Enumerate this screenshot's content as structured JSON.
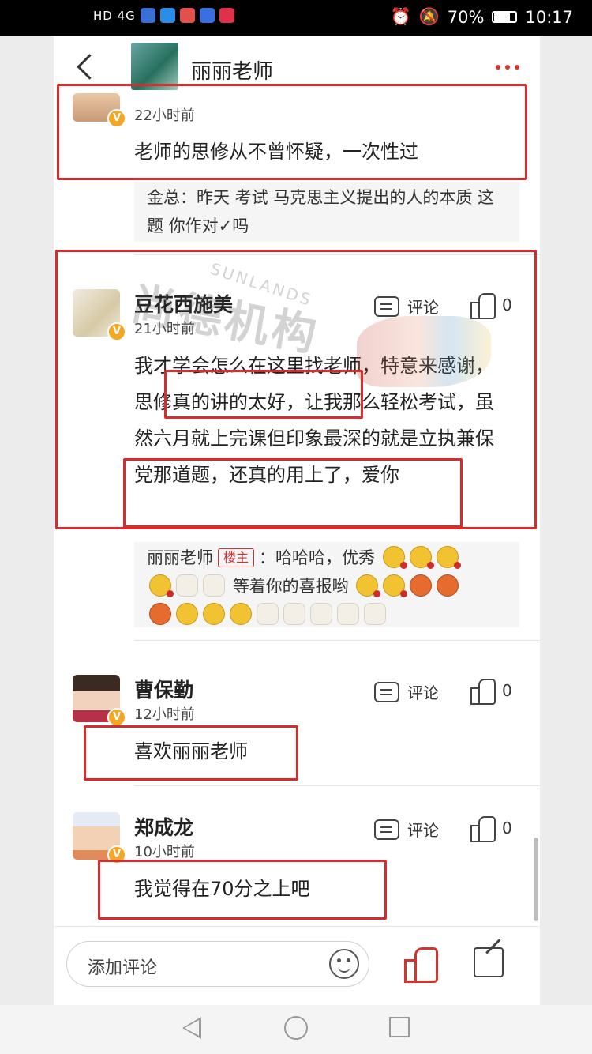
{
  "status_bar": {
    "left_text": "HD 4G",
    "battery": "70%",
    "time": "10:17"
  },
  "header": {
    "title": "丽丽老师"
  },
  "comments": [
    {
      "time": "22小时前",
      "text": "老师的思修从不曾怀疑，一次性过",
      "reply": "金总：昨天  考试 马克思主义提出的人的本质 这题 你作对✓吗"
    },
    {
      "name": "豆花西施美",
      "time": "21小时前",
      "comment_label": "评论",
      "likes": "0",
      "text": "我才学会怎么在这里找老师，特意来感谢，思修真的讲的太好，让我那么轻松考试，虽然六月就上完课但印象最深的就是立执兼保党那道题，还真的用上了，爱你",
      "reply_author": "丽丽老师",
      "reply_tag": "楼主",
      "reply_text": "：哈哈哈，优秀",
      "reply_text2": "等着你的喜报哟"
    },
    {
      "name": "曹保勤",
      "time": "12小时前",
      "comment_label": "评论",
      "likes": "0",
      "text": "喜欢丽丽老师"
    },
    {
      "name": "郑成龙",
      "time": "10小时前",
      "comment_label": "评论",
      "likes": "0",
      "text": "我觉得在70分之上吧"
    }
  ],
  "watermark": {
    "brand_cn": "尚德机构",
    "brand_en": "SUNLANDS"
  },
  "bottom_bar": {
    "input_placeholder": "添加评论"
  },
  "colors": {
    "accent": "#d3342c",
    "annotation_box": "#d92b2b",
    "badge": "#f5a623"
  }
}
